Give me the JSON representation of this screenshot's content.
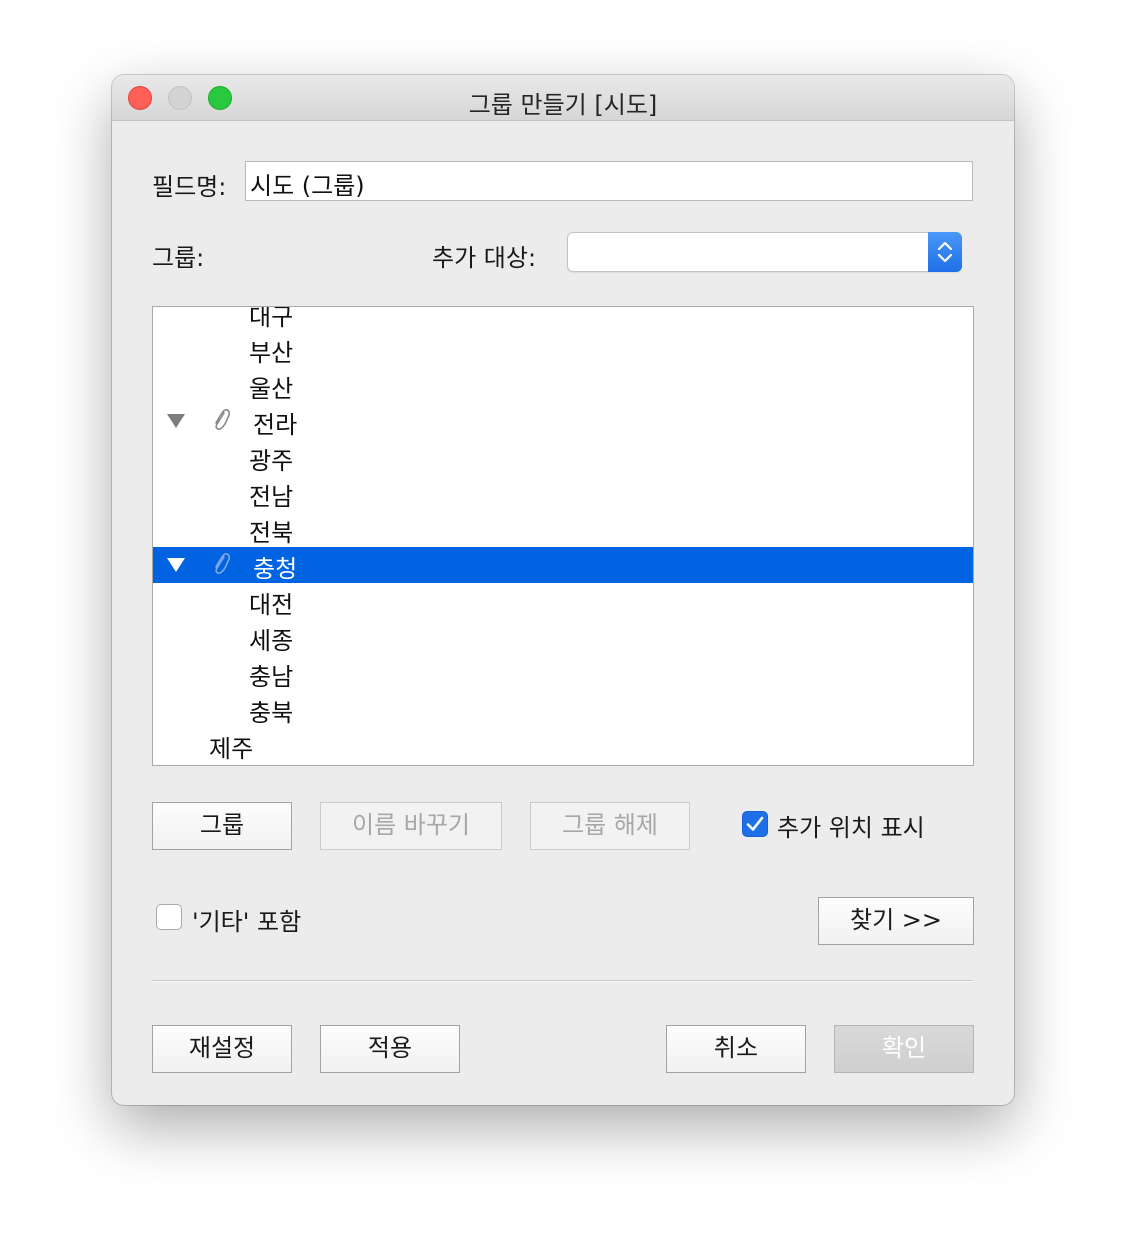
{
  "window": {
    "title": "그룹 만들기 [시도]"
  },
  "form": {
    "field_name_label": "필드명:",
    "field_name_value": "시도 (그룹)",
    "group_label": "그룹:",
    "add_to_label": "추가 대상:",
    "add_to_value": ""
  },
  "tree": {
    "rows": [
      {
        "label": "대구",
        "level": 2
      },
      {
        "label": "부산",
        "level": 2
      },
      {
        "label": "울산",
        "level": 2
      },
      {
        "label": "전라",
        "level": 1,
        "group": true,
        "expanded": true
      },
      {
        "label": "광주",
        "level": 2
      },
      {
        "label": "전남",
        "level": 2
      },
      {
        "label": "전북",
        "level": 2
      },
      {
        "label": "충청",
        "level": 1,
        "group": true,
        "expanded": true,
        "selected": true
      },
      {
        "label": "대전",
        "level": 2
      },
      {
        "label": "세종",
        "level": 2
      },
      {
        "label": "충남",
        "level": 2
      },
      {
        "label": "충북",
        "level": 2
      },
      {
        "label": "제주",
        "level": 1
      }
    ]
  },
  "actions": {
    "group_button": "그룹",
    "rename_button": "이름 바꾸기",
    "ungroup_button": "그룹 해제",
    "show_added_label": "추가 위치 표시",
    "show_added_checked": true,
    "include_other_label": "'기타' 포함",
    "include_other_checked": false,
    "find_button": "찾기 >>"
  },
  "footer": {
    "reset_button": "재설정",
    "apply_button": "적용",
    "cancel_button": "취소",
    "ok_button": "확인"
  },
  "colors": {
    "selection": "#0063e1",
    "accent": "#1f6fe8"
  }
}
